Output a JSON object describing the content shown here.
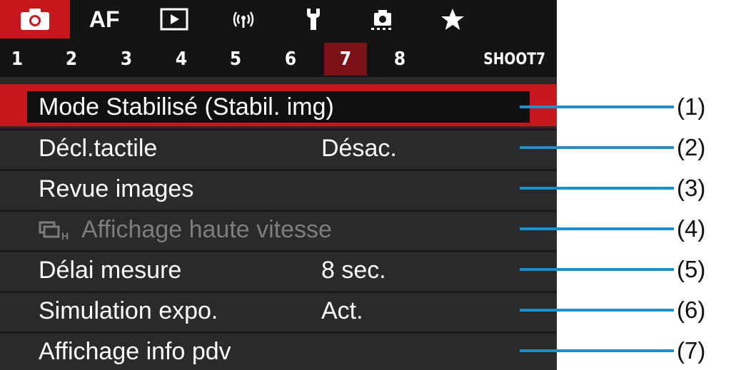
{
  "tabs": [
    {
      "icon": "camera-icon",
      "active": true
    },
    {
      "text": "AF"
    },
    {
      "icon": "playback-icon"
    },
    {
      "icon": "wireless-icon"
    },
    {
      "icon": "wrench-icon"
    },
    {
      "icon": "custom-function-icon"
    },
    {
      "icon": "star-icon"
    }
  ],
  "subtabs": {
    "items": [
      "1",
      "2",
      "3",
      "4",
      "5",
      "6",
      "7",
      "8"
    ],
    "active_index": 6,
    "name": "SHOOT7"
  },
  "rows": [
    {
      "label": "Mode Stabilisé (Stabil. img)",
      "value": "",
      "selected": true
    },
    {
      "label": "Décl.tactile",
      "value": "Désac."
    },
    {
      "label": "Revue images",
      "value": ""
    },
    {
      "label": "Affichage haute vitesse",
      "value": "",
      "disabled": true,
      "icon": "burst-h-icon"
    },
    {
      "label": "Délai mesure",
      "value": "8 sec."
    },
    {
      "label": "Simulation expo.",
      "value": "Act."
    },
    {
      "label": "Affichage info pdv",
      "value": ""
    }
  ],
  "callouts": [
    "(1)",
    "(2)",
    "(3)",
    "(4)",
    "(5)",
    "(6)",
    "(7)"
  ],
  "colors": {
    "accent_red": "#c8161d",
    "subtab_active": "#7a1217",
    "callout_blue": "#1b8fd0",
    "menu_bg": "#2a2a2a",
    "disabled_text": "#7d7d7d"
  }
}
